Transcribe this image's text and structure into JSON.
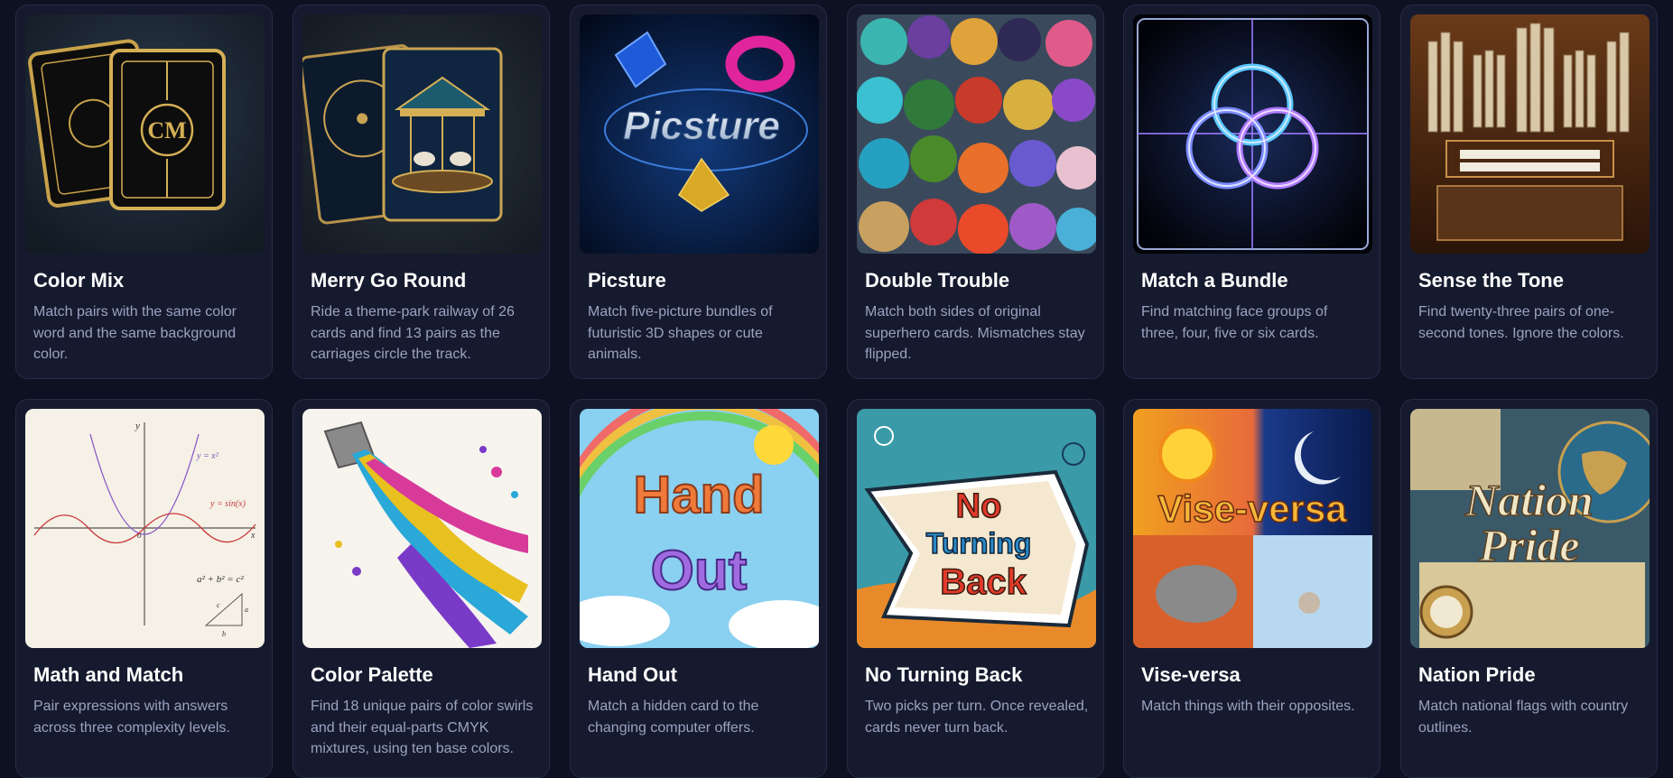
{
  "games": [
    {
      "title": "Color Mix",
      "description": "Match pairs with the same color word and the same background color.",
      "art_text": "CM"
    },
    {
      "title": "Merry Go Round",
      "description": "Ride a theme-park railway of 26 cards and find 13 pairs as the carriages circle the track."
    },
    {
      "title": "Picsture",
      "description": "Match five-picture bundles of futuristic 3D shapes or cute animals.",
      "art_text": "Picsture"
    },
    {
      "title": "Double Trouble",
      "description": "Match both sides of original superhero cards. Mismatches stay flipped."
    },
    {
      "title": "Match a Bundle",
      "description": "Find matching face groups of three, four, five or six cards."
    },
    {
      "title": "Sense the Tone",
      "description": "Find twenty-three pairs of one-second tones. Ignore the colors."
    },
    {
      "title": "Math and Match",
      "description": "Pair expressions with answers across three complexity levels.",
      "art_text": [
        "y",
        "y = x²",
        "y = sin(x)",
        "x",
        "o",
        "a² + b² = c²",
        "c",
        "a",
        "b"
      ]
    },
    {
      "title": "Color Palette",
      "description": "Find 18 unique pairs of color swirls and their equal-parts CMYK mixtures, using ten base colors."
    },
    {
      "title": "Hand Out",
      "description": "Match a hidden card to the changing computer offers.",
      "art_text": [
        "Hand",
        "Out"
      ]
    },
    {
      "title": "No Turning Back",
      "description": "Two picks per turn. Once revealed, cards never turn back.",
      "art_text": [
        "No",
        "Turning",
        "Back"
      ]
    },
    {
      "title": "Vise-versa",
      "description": "Match things with their opposites.",
      "art_text": "Vise-versa"
    },
    {
      "title": "Nation Pride",
      "description": "Match national flags with country outlines.",
      "art_text": [
        "Nation",
        "Pride"
      ]
    }
  ]
}
